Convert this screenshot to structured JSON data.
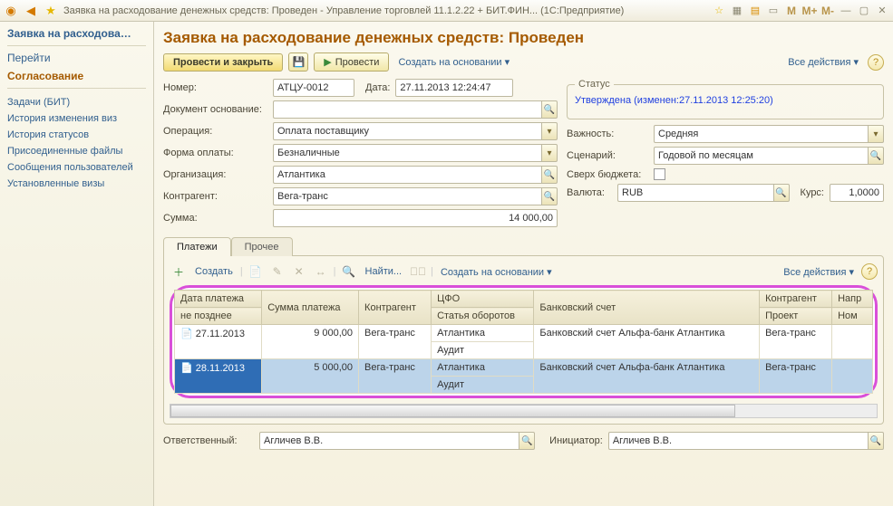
{
  "titlebar": {
    "title": "Заявка на расходование денежных средств: Проведен - Управление торговлей 11.1.2.22 + БИТ.ФИН... (1С:Предприятие)"
  },
  "sidebar": {
    "current_tab": "Заявка на расходова…",
    "nav1": "Перейти",
    "nav2": "Согласование",
    "links": [
      "Задачи (БИТ)",
      "История изменения виз",
      "История статусов",
      "Присоединенные файлы",
      "Сообщения пользователей",
      "Установленные визы"
    ]
  },
  "doc": {
    "title": "Заявка на расходование денежных средств: Проведен",
    "toolbar": {
      "post_close": "Провести и закрыть",
      "post": "Провести",
      "create_based": "Создать на основании",
      "all_actions": "Все действия"
    },
    "labels": {
      "number": "Номер:",
      "date": "Дата:",
      "basis": "Документ основание:",
      "operation": "Операция:",
      "pay_form": "Форма оплаты:",
      "importance": "Важность:",
      "org": "Организация:",
      "scenario": "Сценарий:",
      "counterparty": "Контрагент:",
      "over_budget": "Сверх бюджета:",
      "sum": "Сумма:",
      "currency": "Валюта:",
      "rate": "Курс:",
      "status_legend": "Статус",
      "responsible": "Ответственный:",
      "initiator": "Инициатор:"
    },
    "values": {
      "number": "АТЦУ-0012",
      "date": "27.11.2013 12:24:47",
      "basis": "",
      "operation": "Оплата поставщику",
      "pay_form": "Безналичные",
      "importance": "Средняя",
      "org": "Атлантика",
      "scenario": "Годовой по месяцам",
      "counterparty": "Вега-транс",
      "sum": "14 000,00",
      "currency": "RUB",
      "rate": "1,0000",
      "status_link": "Утверждена (изменен:27.11.2013 12:25:20)",
      "responsible": "Агличев В.В.",
      "initiator": "Агличев В.В."
    },
    "tabs": {
      "payments": "Платежи",
      "other": "Прочее"
    },
    "grid_toolbar": {
      "create": "Создать",
      "find": "Найти...",
      "create_based": "Создать на основании",
      "all_actions": "Все действия"
    },
    "grid": {
      "headers": {
        "date1": "Дата платежа",
        "date2": "не позднее",
        "sum": "Сумма платежа",
        "cp": "Контрагент",
        "cfo1": "ЦФО",
        "cfo2": "Статья оборотов",
        "bank": "Банковский счет",
        "cp2a": "Контрагент",
        "cp2b": "Проект",
        "dir": "Напр",
        "num": "Ном"
      },
      "rows": [
        {
          "date": "27.11.2013",
          "sum": "9 000,00",
          "cp": "Вега-транс",
          "cfo": "Атлантика",
          "turnover": "Аудит",
          "bank": "Банковский счет Альфа-банк Атлантика",
          "cp2": "Вега-транс",
          "selected": false
        },
        {
          "date": "28.11.2013",
          "sum": "5 000,00",
          "cp": "Вега-транс",
          "cfo": "Атлантика",
          "turnover": "Аудит",
          "bank": "Банковский счет Альфа-банк Атлантика",
          "cp2": "Вега-транс",
          "selected": true
        }
      ]
    }
  }
}
